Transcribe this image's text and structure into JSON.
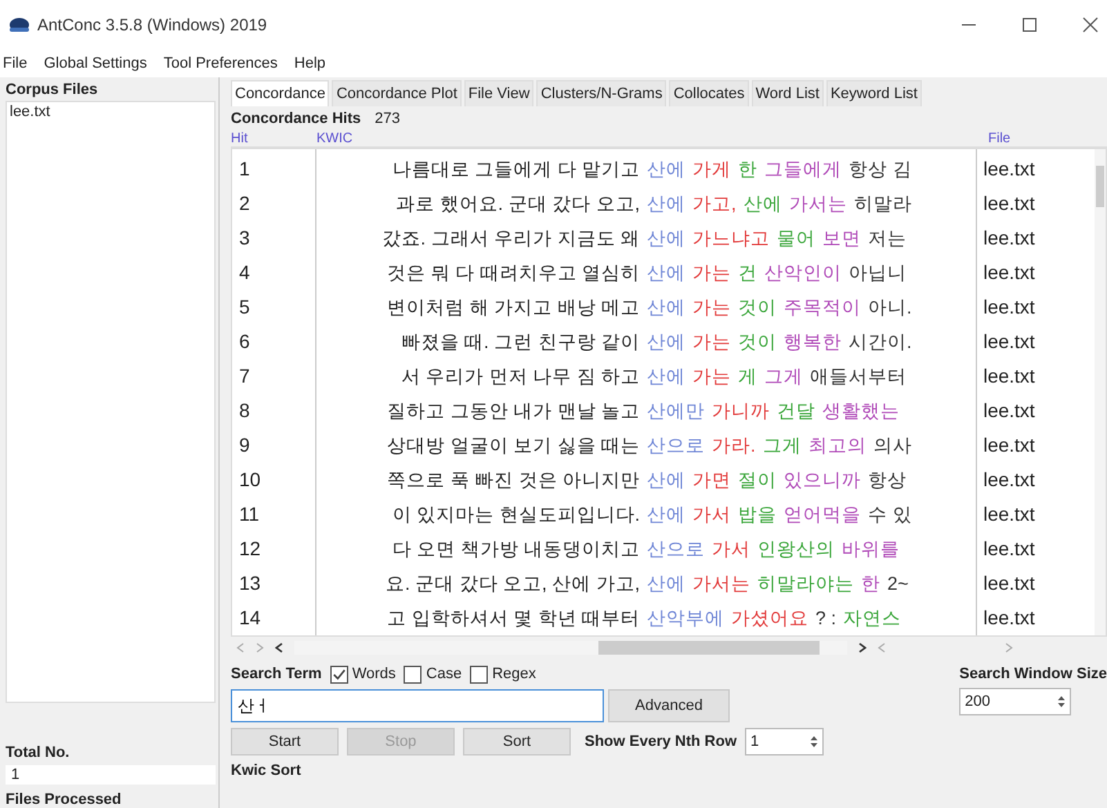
{
  "window": {
    "title": "AntConc 3.5.8 (Windows) 2019"
  },
  "menu": [
    "File",
    "Global Settings",
    "Tool Preferences",
    "Help"
  ],
  "sidebar": {
    "heading": "Corpus Files",
    "files": [
      {
        "name": "lee.txt",
        "selected": false
      }
    ],
    "total_label": "Total No.",
    "total_value": "1",
    "processed_label": "Files Processed"
  },
  "tabs": [
    {
      "label": "Concordance",
      "selected": true
    },
    {
      "label": "Concordance Plot",
      "selected": false
    },
    {
      "label": "File View",
      "selected": false
    },
    {
      "label": "Clusters/N-Grams",
      "selected": false
    },
    {
      "label": "Collocates",
      "selected": false
    },
    {
      "label": "Word List",
      "selected": false
    },
    {
      "label": "Keyword List",
      "selected": false
    }
  ],
  "hits": {
    "label": "Concordance Hits",
    "value": "273"
  },
  "table": {
    "columns": [
      "Hit",
      "KWIC",
      "File"
    ],
    "rows": [
      {
        "hit": "1",
        "left": "나름대로 그들에게 다 맡기고",
        "parts": [
          {
            "text": "산에",
            "color": "#6f86d6"
          },
          {
            "text": "가게",
            "color": "#e23a3a"
          },
          {
            "text": "한",
            "color": "#3aa63a"
          },
          {
            "text": "그들에게",
            "color": "#b04ab8"
          },
          {
            "text": "항상 김",
            "color": "#333333"
          }
        ],
        "file": "lee.txt"
      },
      {
        "hit": "2",
        "left": "과로 했어요. 군대 갔다 오고,",
        "parts": [
          {
            "text": "산에",
            "color": "#6f86d6"
          },
          {
            "text": "가고,",
            "color": "#e23a3a"
          },
          {
            "text": "산에",
            "color": "#3aa63a"
          },
          {
            "text": "가서는",
            "color": "#b04ab8"
          },
          {
            "text": "히말라",
            "color": "#333333"
          }
        ],
        "file": "lee.txt"
      },
      {
        "hit": "3",
        "left": "갔죠. 그래서 우리가 지금도 왜",
        "parts": [
          {
            "text": "산에",
            "color": "#6f86d6"
          },
          {
            "text": "가느냐고",
            "color": "#e23a3a"
          },
          {
            "text": "물어",
            "color": "#3aa63a"
          },
          {
            "text": "보면",
            "color": "#b04ab8"
          },
          {
            "text": "저는",
            "color": "#333333"
          }
        ],
        "file": "lee.txt"
      },
      {
        "hit": "4",
        "left": "것은 뭐 다 때려치우고 열심히",
        "parts": [
          {
            "text": "산에",
            "color": "#6f86d6"
          },
          {
            "text": "가는",
            "color": "#e23a3a"
          },
          {
            "text": "건",
            "color": "#3aa63a"
          },
          {
            "text": "산악인이",
            "color": "#b04ab8"
          },
          {
            "text": "아닙니",
            "color": "#333333"
          }
        ],
        "file": "lee.txt"
      },
      {
        "hit": "5",
        "left": "변이처럼 해 가지고 배낭 메고",
        "parts": [
          {
            "text": "산에",
            "color": "#6f86d6"
          },
          {
            "text": "가는",
            "color": "#e23a3a"
          },
          {
            "text": "것이",
            "color": "#3aa63a"
          },
          {
            "text": "주목적이",
            "color": "#b04ab8"
          },
          {
            "text": "아니.",
            "color": "#333333"
          }
        ],
        "file": "lee.txt"
      },
      {
        "hit": "6",
        "left": "빠졌을 때. 그런 친구랑 같이",
        "parts": [
          {
            "text": "산에",
            "color": "#6f86d6"
          },
          {
            "text": "가는",
            "color": "#e23a3a"
          },
          {
            "text": "것이",
            "color": "#3aa63a"
          },
          {
            "text": "행복한",
            "color": "#b04ab8"
          },
          {
            "text": "시간이.",
            "color": "#333333"
          }
        ],
        "file": "lee.txt"
      },
      {
        "hit": "7",
        "left": "서 우리가 먼저 나무 짐 하고",
        "parts": [
          {
            "text": "산에",
            "color": "#6f86d6"
          },
          {
            "text": "가는",
            "color": "#e23a3a"
          },
          {
            "text": "게",
            "color": "#3aa63a"
          },
          {
            "text": "그게",
            "color": "#b04ab8"
          },
          {
            "text": "애들서부터",
            "color": "#333333"
          }
        ],
        "file": "lee.txt"
      },
      {
        "hit": "8",
        "left": "질하고 그동안 내가 맨날 놀고",
        "parts": [
          {
            "text": "산에만",
            "color": "#6f86d6"
          },
          {
            "text": "가니까",
            "color": "#e23a3a"
          },
          {
            "text": "건달",
            "color": "#3aa63a"
          },
          {
            "text": "생활했는",
            "color": "#b04ab8"
          }
        ],
        "file": "lee.txt"
      },
      {
        "hit": "9",
        "left": "상대방 얼굴이 보기 싫을 때는",
        "parts": [
          {
            "text": "산으로",
            "color": "#6f86d6"
          },
          {
            "text": "가라.",
            "color": "#e23a3a"
          },
          {
            "text": "그게",
            "color": "#3aa63a"
          },
          {
            "text": "최고의",
            "color": "#b04ab8"
          },
          {
            "text": "의사",
            "color": "#333333"
          }
        ],
        "file": "lee.txt"
      },
      {
        "hit": "10",
        "left": "쪽으로 푹 빠진 것은 아니지만",
        "parts": [
          {
            "text": "산에",
            "color": "#6f86d6"
          },
          {
            "text": "가면",
            "color": "#e23a3a"
          },
          {
            "text": "절이",
            "color": "#3aa63a"
          },
          {
            "text": "있으니까",
            "color": "#b04ab8"
          },
          {
            "text": "항상",
            "color": "#333333"
          }
        ],
        "file": "lee.txt"
      },
      {
        "hit": "11",
        "left": "이 있지마는 현실도피입니다.",
        "parts": [
          {
            "text": "산에",
            "color": "#6f86d6"
          },
          {
            "text": "가서",
            "color": "#e23a3a"
          },
          {
            "text": "밥을",
            "color": "#3aa63a"
          },
          {
            "text": "얻어먹을",
            "color": "#b04ab8"
          },
          {
            "text": "수 있",
            "color": "#333333"
          }
        ],
        "file": "lee.txt"
      },
      {
        "hit": "12",
        "left": "다 오면 책가방 내동댕이치고",
        "parts": [
          {
            "text": "산으로",
            "color": "#6f86d6"
          },
          {
            "text": "가서",
            "color": "#e23a3a"
          },
          {
            "text": "인왕산의",
            "color": "#3aa63a"
          },
          {
            "text": "바위를",
            "color": "#b04ab8"
          }
        ],
        "file": "lee.txt"
      },
      {
        "hit": "13",
        "left": "요. 군대 갔다 오고, 산에 가고,",
        "parts": [
          {
            "text": "산에",
            "color": "#6f86d6"
          },
          {
            "text": "가서는",
            "color": "#e23a3a"
          },
          {
            "text": "히말라야는",
            "color": "#3aa63a"
          },
          {
            "text": "한",
            "color": "#b04ab8"
          },
          {
            "text": "2~",
            "color": "#333333"
          }
        ],
        "file": "lee.txt"
      },
      {
        "hit": "14",
        "left": "고 입학하셔서 몇 학년 때부터",
        "parts": [
          {
            "text": "산악부에",
            "color": "#6f86d6"
          },
          {
            "text": "가셨어요",
            "color": "#e23a3a"
          },
          {
            "text": "?  :",
            "color": "#333333"
          },
          {
            "text": "자연스",
            "color": "#3aa63a"
          }
        ],
        "file": "lee.txt"
      }
    ]
  },
  "search": {
    "label": "Search Term",
    "options": [
      {
        "label": "Words",
        "checked": true
      },
      {
        "label": "Case",
        "checked": false
      },
      {
        "label": "Regex",
        "checked": false
      }
    ],
    "value": "산ㅓ",
    "advanced": "Advanced",
    "window_label": "Search Window Size",
    "window_value": "200"
  },
  "buttons": [
    {
      "label": "Start",
      "disabled": false
    },
    {
      "label": "Stop",
      "disabled": true
    },
    {
      "label": "Sort",
      "disabled": false
    }
  ],
  "nth": {
    "label": "Show Every Nth Row",
    "value": "1"
  },
  "kwic_sort": {
    "label": "Kwic Sort"
  }
}
